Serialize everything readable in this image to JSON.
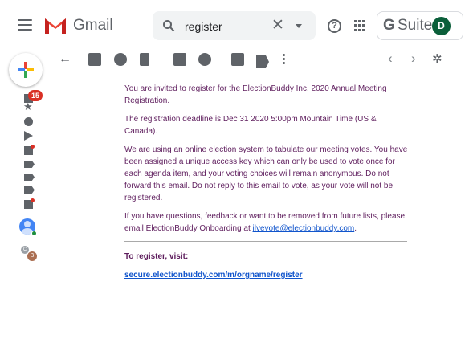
{
  "header": {
    "app_name": "Gmail",
    "search_value": "register",
    "search_clear": "✕",
    "help_glyph": "?",
    "gsuite_g": "G",
    "gsuite_label": "Suite",
    "account_initial": "D"
  },
  "sidebar": {
    "inbox_badge": "15",
    "contacts": [
      "C",
      "B"
    ]
  },
  "toolbar": {
    "back_glyph": "←",
    "prev_glyph": "‹",
    "next_glyph": "›",
    "settings_glyph": "✲"
  },
  "email": {
    "para1": "You are invited to register for the ElectionBuddy Inc. 2020 Annual Meeting Registration.",
    "para2": "The registration deadline is Dec 31 2020 5:00pm Mountain Time (US & Canada).",
    "para3": "We are using an online election system to tabulate our meeting votes. You have been assigned a unique access key which can only be used to vote once for each agenda item, and your voting choices will remain anonymous. Do not forward this email. Do not reply to this email to vote, as your vote will not be registered.",
    "para4_prefix": "If you have questions, feedback or want to be removed from future lists, please email ElectionBuddy Onboarding at ",
    "para4_link": "ilvevote@electionbuddy.com",
    "para4_suffix": ".",
    "register_heading": "To register, visit:",
    "register_link": "secure.electionbuddy.com/m/orgname/register"
  },
  "colors": {
    "body_text": "#5e1d5d",
    "link": "#1155cc",
    "badge": "#d93025",
    "account_avatar": "#0b5f3a"
  },
  "icons": [
    "menu-icon",
    "gmail-logo",
    "search-icon",
    "clear-search-icon",
    "dropdown-icon",
    "help-icon",
    "apps-icon",
    "compose-icon",
    "inbox-icon",
    "star-icon",
    "clock-icon",
    "send-icon",
    "doc-icon",
    "label-icon",
    "back-icon",
    "archive-icon",
    "report-spam-icon",
    "delete-icon",
    "mark-unread-icon",
    "snooze-icon",
    "move-to-icon",
    "labels-icon",
    "more-icon",
    "prev-icon",
    "next-icon",
    "settings-icon"
  ]
}
